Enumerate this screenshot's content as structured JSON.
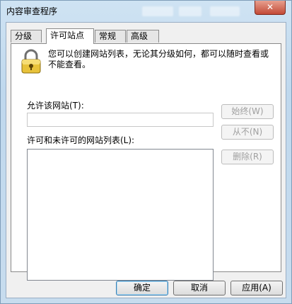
{
  "window": {
    "title": "内容审查程序",
    "close_label": "✕"
  },
  "tabs": [
    {
      "label": "分级"
    },
    {
      "label": "许可站点"
    },
    {
      "label": "常规"
    },
    {
      "label": "高级"
    }
  ],
  "panel": {
    "description": "您可以创建网站列表，无论其分级如何，都可以随时查看或不能查看。",
    "allow_site_label": "允许该网站(T):",
    "allow_site_value": "",
    "list_label": "许可和未许可的网站列表(L):",
    "list_items": [],
    "buttons": {
      "always": "始终(W)",
      "never": "从不(N)",
      "remove": "删除(R)"
    }
  },
  "footer": {
    "ok": "确定",
    "cancel": "取消",
    "apply": "应用(A)"
  },
  "colors": {
    "accent": "#3c7fb1",
    "close": "#c24a36"
  }
}
